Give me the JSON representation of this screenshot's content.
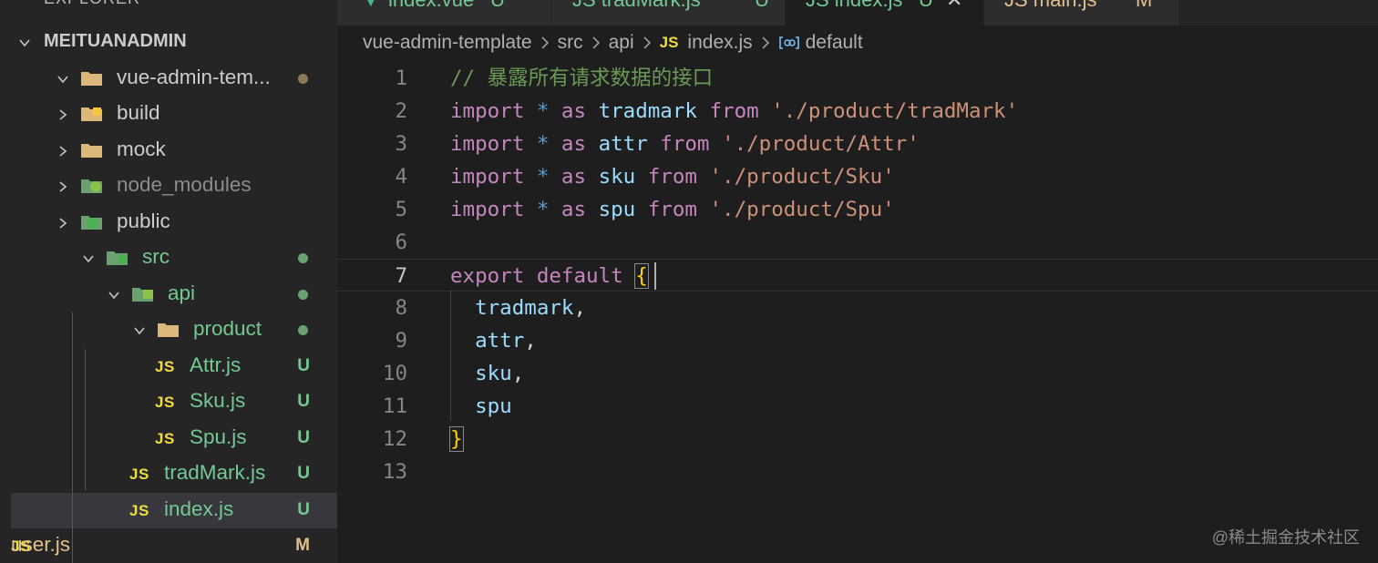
{
  "colors": {
    "js_badge": "#f1dd3f",
    "untracked": "#73c991",
    "modified": "#e2c08d",
    "folder_dot": "#6aa171",
    "comment": "#6a9955",
    "keyword": "#c586c0",
    "identifier": "#9cdcfe",
    "string": "#ce9178"
  },
  "sidebar": {
    "header": "EXPLORER",
    "project": "MEITUANADMIN",
    "items": [
      {
        "label": "vue-admin-tem...",
        "icon": "folder-open-icon",
        "expanded": true,
        "status": "dot"
      },
      {
        "label": "build",
        "icon": "folder-build-icon",
        "expanded": false,
        "status": ""
      },
      {
        "label": "mock",
        "icon": "folder-icon",
        "expanded": false,
        "status": ""
      },
      {
        "label": "node_modules",
        "icon": "folder-node-icon",
        "expanded": false,
        "status": ""
      },
      {
        "label": "public",
        "icon": "folder-public-icon",
        "expanded": false,
        "status": ""
      },
      {
        "label": "src",
        "icon": "folder-src-icon",
        "expanded": true,
        "status": "dot"
      },
      {
        "label": "api",
        "icon": "folder-api-icon",
        "expanded": true,
        "status": "dot"
      },
      {
        "label": "product",
        "icon": "folder-open-icon",
        "expanded": true,
        "status": "dot"
      },
      {
        "label": "Attr.js",
        "icon": "js-icon",
        "badge": "JS",
        "status": "U"
      },
      {
        "label": "Sku.js",
        "icon": "js-icon",
        "badge": "JS",
        "status": "U"
      },
      {
        "label": "Spu.js",
        "icon": "js-icon",
        "badge": "JS",
        "status": "U"
      },
      {
        "label": "tradMark.js",
        "icon": "js-icon",
        "badge": "JS",
        "status": "U"
      },
      {
        "label": "index.js",
        "icon": "js-icon",
        "badge": "JS",
        "status": "U",
        "selected": true
      },
      {
        "label": "user.js",
        "icon": "js-icon",
        "badge": "JS",
        "status": "M"
      }
    ]
  },
  "tabs": [
    {
      "label": "index.vue",
      "status": "U",
      "icon": "vue-icon"
    },
    {
      "label": "JS  tradMark.js",
      "status": "U"
    },
    {
      "label": "JS  index.js",
      "status": "U",
      "active": true,
      "close": "✕"
    },
    {
      "label": "JS  main.js",
      "status": "M"
    }
  ],
  "breadcrumb": {
    "parts": [
      "vue-admin-template",
      "src",
      "api"
    ],
    "file_badge": "JS",
    "file": "index.js",
    "symbol": "default"
  },
  "editor": {
    "current_line": 7,
    "lines": [
      {
        "n": "1",
        "tokens": [
          {
            "t": "// 暴露所有请求数据的接口",
            "c": "comment"
          }
        ]
      },
      {
        "n": "2",
        "tokens": [
          {
            "t": "import",
            "c": "kw"
          },
          {
            "t": " ",
            "c": "punc"
          },
          {
            "t": "*",
            "c": "op"
          },
          {
            "t": " ",
            "c": "punc"
          },
          {
            "t": "as",
            "c": "kw"
          },
          {
            "t": " ",
            "c": "punc"
          },
          {
            "t": "tradmark",
            "c": "id"
          },
          {
            "t": " ",
            "c": "punc"
          },
          {
            "t": "from",
            "c": "kw"
          },
          {
            "t": " ",
            "c": "punc"
          },
          {
            "t": "'./product/tradMark'",
            "c": "str"
          }
        ]
      },
      {
        "n": "3",
        "tokens": [
          {
            "t": "import",
            "c": "kw"
          },
          {
            "t": " ",
            "c": "punc"
          },
          {
            "t": "*",
            "c": "op"
          },
          {
            "t": " ",
            "c": "punc"
          },
          {
            "t": "as",
            "c": "kw"
          },
          {
            "t": " ",
            "c": "punc"
          },
          {
            "t": "attr",
            "c": "id"
          },
          {
            "t": " ",
            "c": "punc"
          },
          {
            "t": "from",
            "c": "kw"
          },
          {
            "t": " ",
            "c": "punc"
          },
          {
            "t": "'./product/Attr'",
            "c": "str"
          }
        ]
      },
      {
        "n": "4",
        "tokens": [
          {
            "t": "import",
            "c": "kw"
          },
          {
            "t": " ",
            "c": "punc"
          },
          {
            "t": "*",
            "c": "op"
          },
          {
            "t": " ",
            "c": "punc"
          },
          {
            "t": "as",
            "c": "kw"
          },
          {
            "t": " ",
            "c": "punc"
          },
          {
            "t": "sku",
            "c": "id"
          },
          {
            "t": " ",
            "c": "punc"
          },
          {
            "t": "from",
            "c": "kw"
          },
          {
            "t": " ",
            "c": "punc"
          },
          {
            "t": "'./product/Sku'",
            "c": "str"
          }
        ]
      },
      {
        "n": "5",
        "tokens": [
          {
            "t": "import",
            "c": "kw"
          },
          {
            "t": " ",
            "c": "punc"
          },
          {
            "t": "*",
            "c": "op"
          },
          {
            "t": " ",
            "c": "punc"
          },
          {
            "t": "as",
            "c": "kw"
          },
          {
            "t": " ",
            "c": "punc"
          },
          {
            "t": "spu",
            "c": "id"
          },
          {
            "t": " ",
            "c": "punc"
          },
          {
            "t": "from",
            "c": "kw"
          },
          {
            "t": " ",
            "c": "punc"
          },
          {
            "t": "'./product/Spu'",
            "c": "str"
          }
        ]
      },
      {
        "n": "6",
        "tokens": []
      },
      {
        "n": "7",
        "tokens": [
          {
            "t": "export",
            "c": "kw"
          },
          {
            "t": " ",
            "c": "punc"
          },
          {
            "t": "default",
            "c": "kw"
          },
          {
            "t": " ",
            "c": "punc"
          },
          {
            "t": "{",
            "c": "brace"
          }
        ]
      },
      {
        "n": "8",
        "tokens": [
          {
            "t": "  ",
            "c": "punc"
          },
          {
            "t": "tradmark",
            "c": "id"
          },
          {
            "t": ",",
            "c": "punc"
          }
        ]
      },
      {
        "n": "9",
        "tokens": [
          {
            "t": "  ",
            "c": "punc"
          },
          {
            "t": "attr",
            "c": "id"
          },
          {
            "t": ",",
            "c": "punc"
          }
        ]
      },
      {
        "n": "10",
        "tokens": [
          {
            "t": "  ",
            "c": "punc"
          },
          {
            "t": "sku",
            "c": "id"
          },
          {
            "t": ",",
            "c": "punc"
          }
        ]
      },
      {
        "n": "11",
        "tokens": [
          {
            "t": "  ",
            "c": "punc"
          },
          {
            "t": "spu",
            "c": "id"
          }
        ]
      },
      {
        "n": "12",
        "tokens": [
          {
            "t": "}",
            "c": "brace"
          }
        ]
      },
      {
        "n": "13",
        "tokens": []
      }
    ]
  },
  "watermark": "@稀土掘金技术社区"
}
